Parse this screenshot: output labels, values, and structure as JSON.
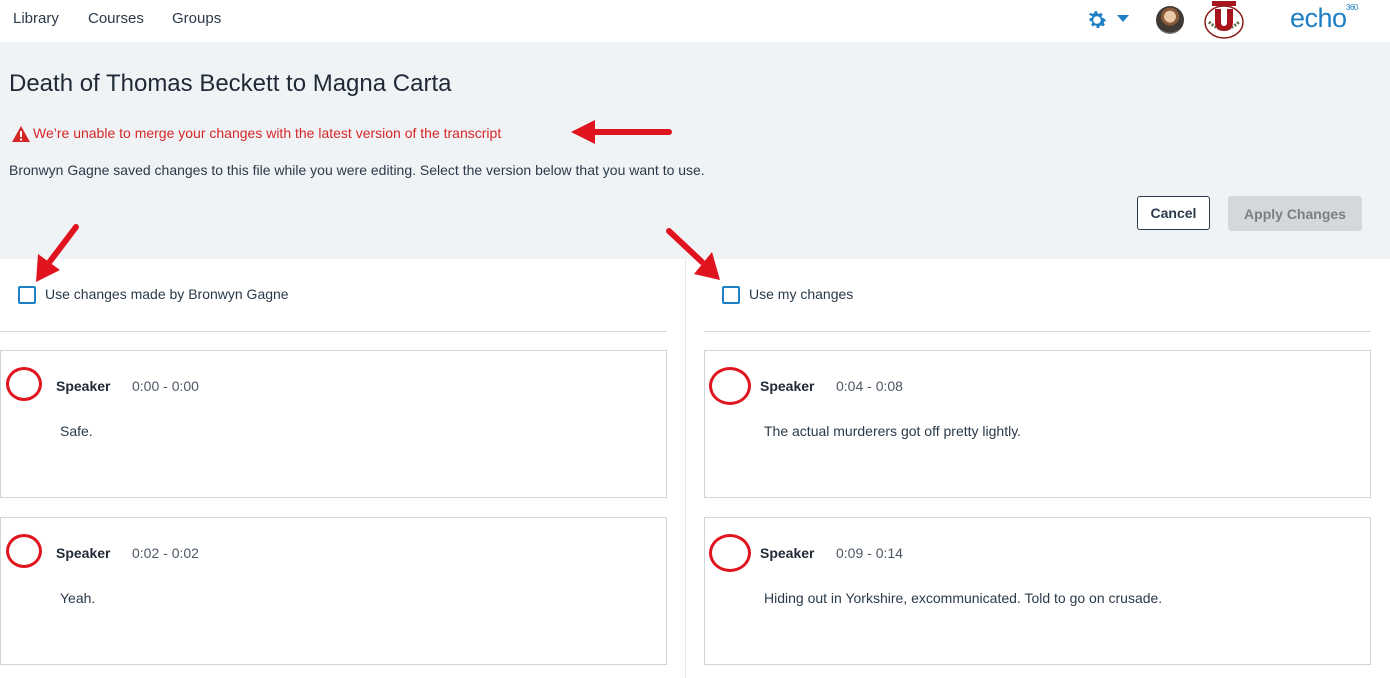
{
  "nav": {
    "links": [
      "Library",
      "Courses",
      "Groups"
    ],
    "brand": "echo",
    "brand_sup": "360"
  },
  "page": {
    "title": "Death of Thomas Beckett to Magna Carta",
    "warning": "We’re unable to merge your changes with the latest version of the transcript",
    "description": "Bronwyn Gagne saved changes to this file while you were editing. Select the version below that you want to use.",
    "cancel_label": "Cancel",
    "apply_label": "Apply Changes"
  },
  "left": {
    "checkbox_label": "Use changes made by Bronwyn Gagne",
    "segments": [
      {
        "speaker": "Speaker",
        "time": "0:00 - 0:00",
        "text": "Safe."
      },
      {
        "speaker": "Speaker",
        "time": "0:02 - 0:02",
        "text": "Yeah."
      }
    ]
  },
  "right": {
    "checkbox_label": "Use my changes",
    "segments": [
      {
        "speaker": "Speaker",
        "time": "0:04 - 0:08",
        "text": "The actual murderers got off pretty lightly."
      },
      {
        "speaker": "Speaker",
        "time": "0:09 - 0:14",
        "text": "Hiding out in Yorkshire, excommunicated. Told to go on crusade."
      }
    ]
  },
  "colors": {
    "accent": "#1d7fc4",
    "warning": "#d62728",
    "annotation": "#e0141e",
    "banner_bg": "#f0f3f6"
  },
  "icons": [
    "gear-icon",
    "chevron-down-icon",
    "user-avatar",
    "university-logo",
    "warning-icon",
    "annotation-arrow",
    "annotation-circle"
  ]
}
